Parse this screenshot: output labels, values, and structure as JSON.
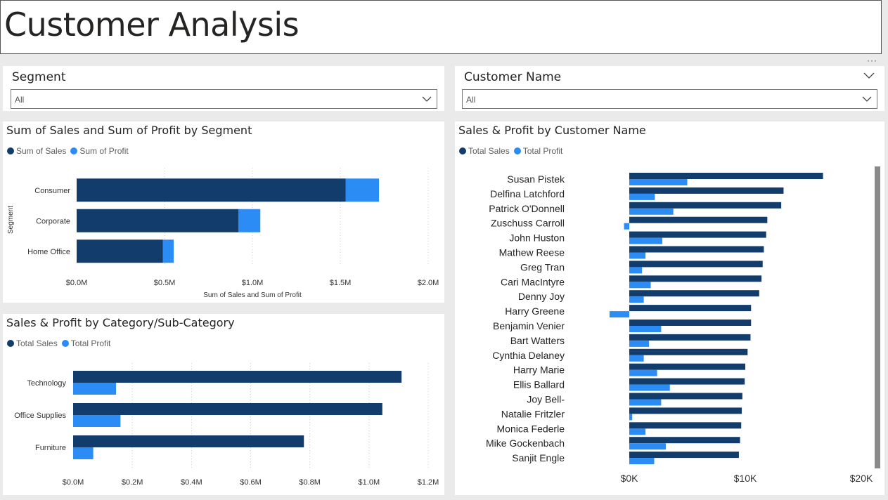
{
  "page": {
    "title": "Customer Analysis"
  },
  "colors": {
    "sales": "#123c6b",
    "profit": "#2b8cf5",
    "grid": "#c8c8c8"
  },
  "slicers": {
    "segment": {
      "title": "Segment",
      "value": "All"
    },
    "customer": {
      "title": "Customer Name",
      "value": "All"
    }
  },
  "icons": {
    "more": "more-options-icon",
    "chevron": "chevron-down-icon"
  },
  "chart_data": [
    {
      "id": "segment",
      "type": "bar",
      "title": "Sum of Sales and Sum of Profit by Segment",
      "ylabel": "Segment",
      "xlabel": "Sum of Sales and Sum of Profit",
      "categories": [
        "Consumer",
        "Corporate",
        "Home Office"
      ],
      "series": [
        {
          "name": "Sum of Sales",
          "values": [
            1530000,
            920000,
            490000
          ]
        },
        {
          "name": "Sum of Profit",
          "values": [
            190000,
            125000,
            62000
          ]
        }
      ],
      "stacked": true,
      "xlim": [
        0,
        2000000
      ],
      "ticks": [
        "$0.0M",
        "$0.5M",
        "$1.0M",
        "$1.5M",
        "$2.0M"
      ]
    },
    {
      "id": "category",
      "type": "bar",
      "title": "Sales & Profit by Category/Sub-Category",
      "categories": [
        "Technology",
        "Office Supplies",
        "Furniture"
      ],
      "series": [
        {
          "name": "Total Sales",
          "values": [
            1110000,
            1045000,
            780000
          ]
        },
        {
          "name": "Total Profit",
          "values": [
            145000,
            160000,
            68000
          ]
        }
      ],
      "xlim": [
        0,
        1200000
      ],
      "ticks": [
        "$0.0M",
        "$0.2M",
        "$0.4M",
        "$0.6M",
        "$0.8M",
        "$1.0M",
        "$1.2M"
      ]
    },
    {
      "id": "customer",
      "type": "bar",
      "title": "Sales & Profit by Customer Name",
      "categories": [
        "Susan Pistek",
        "Delfina Latchford",
        "Patrick O'Donnell",
        "Zuschuss Carroll",
        "John Huston",
        "Mathew Reese",
        "Greg Tran",
        "Cari MacIntyre",
        "Denny Joy",
        "Harry Greene",
        "Benjamin Venier",
        "Bart Watters",
        "Cynthia Delaney",
        "Harry Marie",
        "Ellis Ballard",
        "Joy Bell-",
        "Natalie Fritzler",
        "Monica Federle",
        "Mike Gockenbach",
        "Sanjit Engle"
      ],
      "series": [
        {
          "name": "Total Sales",
          "values": [
            16700,
            13300,
            13100,
            11900,
            11800,
            11600,
            11500,
            11400,
            11200,
            10500,
            10500,
            10450,
            10200,
            10000,
            9950,
            9750,
            9700,
            9650,
            9550,
            9450
          ]
        },
        {
          "name": "Total Profit",
          "values": [
            5000,
            2200,
            3800,
            -450,
            2850,
            1400,
            1100,
            1850,
            1250,
            -1700,
            2750,
            1700,
            1250,
            2400,
            3500,
            2750,
            250,
            1400,
            3150,
            2150
          ]
        }
      ],
      "xlim": [
        -2000,
        21000
      ],
      "ticks": [
        "$0K",
        "$10K",
        "$20K"
      ]
    }
  ]
}
